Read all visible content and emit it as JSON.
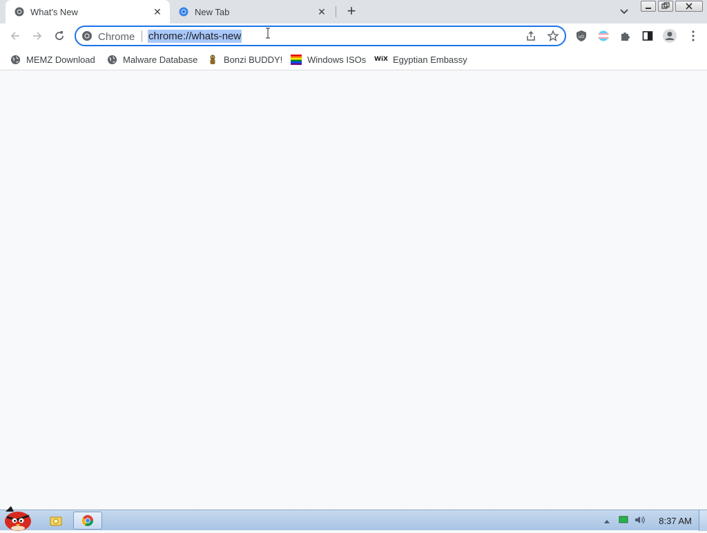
{
  "tabs": [
    {
      "title": "What's New",
      "active": true,
      "icon": "chrome-logo-icon"
    },
    {
      "title": "New Tab",
      "active": false,
      "icon": "chrome-logo-icon"
    }
  ],
  "omnibox": {
    "chip_label": "Chrome",
    "url": "chrome://whats-new",
    "selected": true
  },
  "bookmarks": [
    {
      "label": "MEMZ Download",
      "icon": "globe-icon"
    },
    {
      "label": "Malware Database",
      "icon": "globe-icon"
    },
    {
      "label": "Bonzi BUDDY!",
      "icon": "bonzi-icon"
    },
    {
      "label": "Windows ISOs",
      "icon": "rainbow-flag-icon"
    },
    {
      "label": "Egyptian Embassy",
      "icon": "wix-icon",
      "icon_text": "WiX"
    }
  ],
  "taskbar": {
    "clock": "8:37 AM"
  },
  "colors": {
    "accent": "#1a73e8",
    "selection": "#a8c7fa",
    "tabstrip": "#dee1e6"
  }
}
